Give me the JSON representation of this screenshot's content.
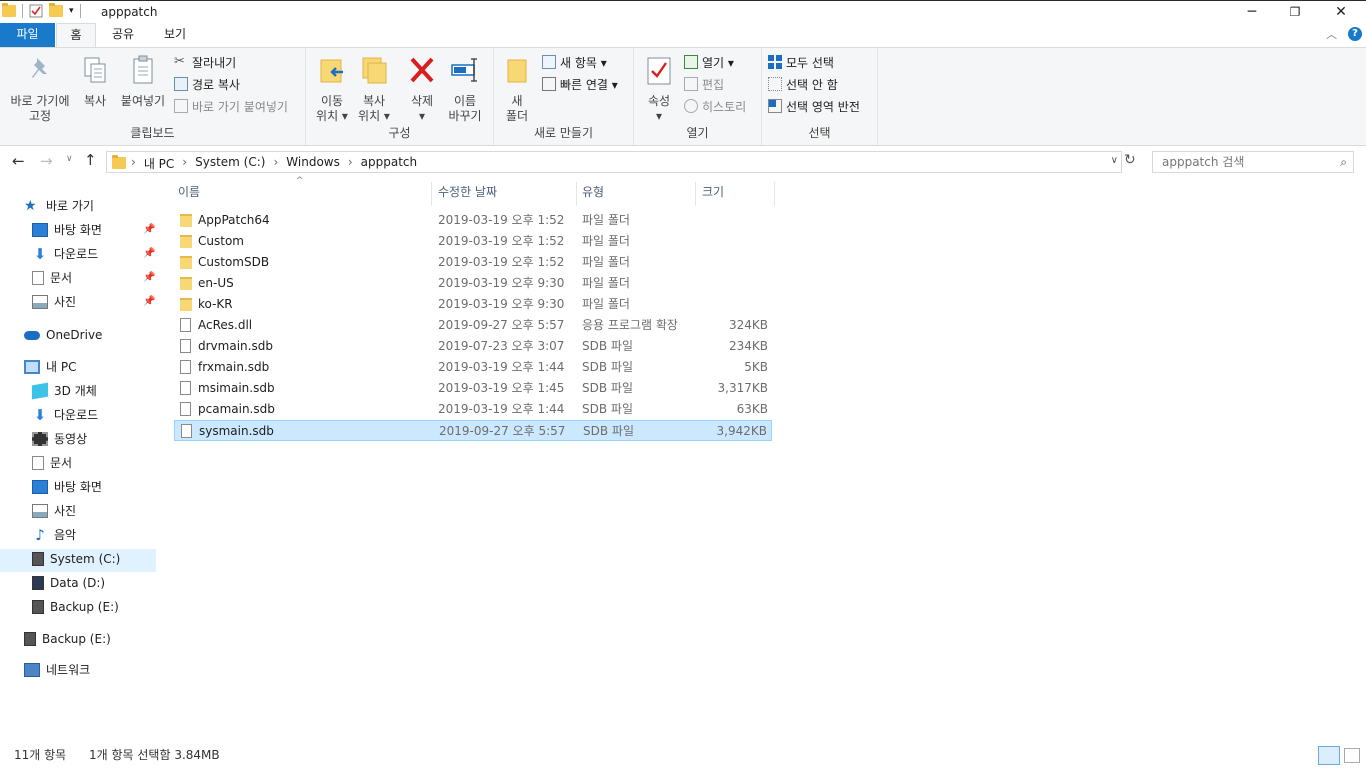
{
  "window": {
    "title": "apppatch",
    "minimize": "─",
    "maximize": "❐",
    "close": "✕"
  },
  "tabs": {
    "file": "파일",
    "home": "홈",
    "share": "공유",
    "view": "보기"
  },
  "ribbon": {
    "clipboard": {
      "label": "클립보드",
      "pin": "바로 가기에\n고정",
      "copy": "복사",
      "paste": "붙여넣기",
      "cut": "잘라내기",
      "copy_path": "경로 복사",
      "paste_shortcut": "바로 가기 붙여넣기"
    },
    "organize": {
      "label": "구성",
      "move": "이동\n위치 ▾",
      "copyto": "복사\n위치 ▾",
      "delete": "삭제\n▾",
      "rename": "이름\n바꾸기"
    },
    "new": {
      "label": "새로 만들기",
      "new_folder": "새\n폴더",
      "new_item": "새 항목 ▾",
      "easy_access": "빠른 연결 ▾"
    },
    "open": {
      "label": "열기",
      "properties": "속성\n▾",
      "open": "열기 ▾",
      "edit": "편집",
      "history": "히스토리"
    },
    "select": {
      "label": "선택",
      "select_all": "모두 선택",
      "select_none": "선택 안 함",
      "invert": "선택 영역 반전"
    }
  },
  "address": {
    "crumbs": [
      "내 PC",
      "System (C:)",
      "Windows",
      "apppatch"
    ],
    "search_placeholder": "apppatch 검색"
  },
  "nav": {
    "quick_access": "바로 가기",
    "quick_items": [
      "바탕 화면",
      "다운로드",
      "문서",
      "사진"
    ],
    "onedrive": "OneDrive",
    "this_pc": "내 PC",
    "pc_items": [
      "3D 개체",
      "다운로드",
      "동영상",
      "문서",
      "바탕 화면",
      "사진",
      "음악",
      "System (C:)",
      "Data (D:)",
      "Backup (E:)"
    ],
    "backup": "Backup (E:)",
    "network": "네트워크"
  },
  "columns": {
    "name": "이름",
    "date": "수정한 날짜",
    "type": "유형",
    "size": "크기"
  },
  "files": [
    {
      "name": "AppPatch64",
      "date": "2019-03-19 오후 1:52",
      "type": "파일 폴더",
      "size": ""
    },
    {
      "name": "Custom",
      "date": "2019-03-19 오후 1:52",
      "type": "파일 폴더",
      "size": ""
    },
    {
      "name": "CustomSDB",
      "date": "2019-03-19 오후 1:52",
      "type": "파일 폴더",
      "size": ""
    },
    {
      "name": "en-US",
      "date": "2019-03-19 오후 9:30",
      "type": "파일 폴더",
      "size": ""
    },
    {
      "name": "ko-KR",
      "date": "2019-03-19 오후 9:30",
      "type": "파일 폴더",
      "size": ""
    },
    {
      "name": "AcRes.dll",
      "date": "2019-09-27 오후 5:57",
      "type": "응용 프로그램 확장",
      "size": "324KB"
    },
    {
      "name": "drvmain.sdb",
      "date": "2019-07-23 오후 3:07",
      "type": "SDB 파일",
      "size": "234KB"
    },
    {
      "name": "frxmain.sdb",
      "date": "2019-03-19 오후 1:44",
      "type": "SDB 파일",
      "size": "5KB"
    },
    {
      "name": "msimain.sdb",
      "date": "2019-03-19 오후 1:45",
      "type": "SDB 파일",
      "size": "3,317KB"
    },
    {
      "name": "pcamain.sdb",
      "date": "2019-03-19 오후 1:44",
      "type": "SDB 파일",
      "size": "63KB"
    },
    {
      "name": "sysmain.sdb",
      "date": "2019-09-27 오후 5:57",
      "type": "SDB 파일",
      "size": "3,942KB"
    }
  ],
  "status": {
    "count": "11개 항목",
    "selection": "1개 항목 선택함 3.84MB"
  },
  "colors": {
    "accent": "#1979ca",
    "selection": "#cce8ff",
    "folder": "#f8d775"
  }
}
